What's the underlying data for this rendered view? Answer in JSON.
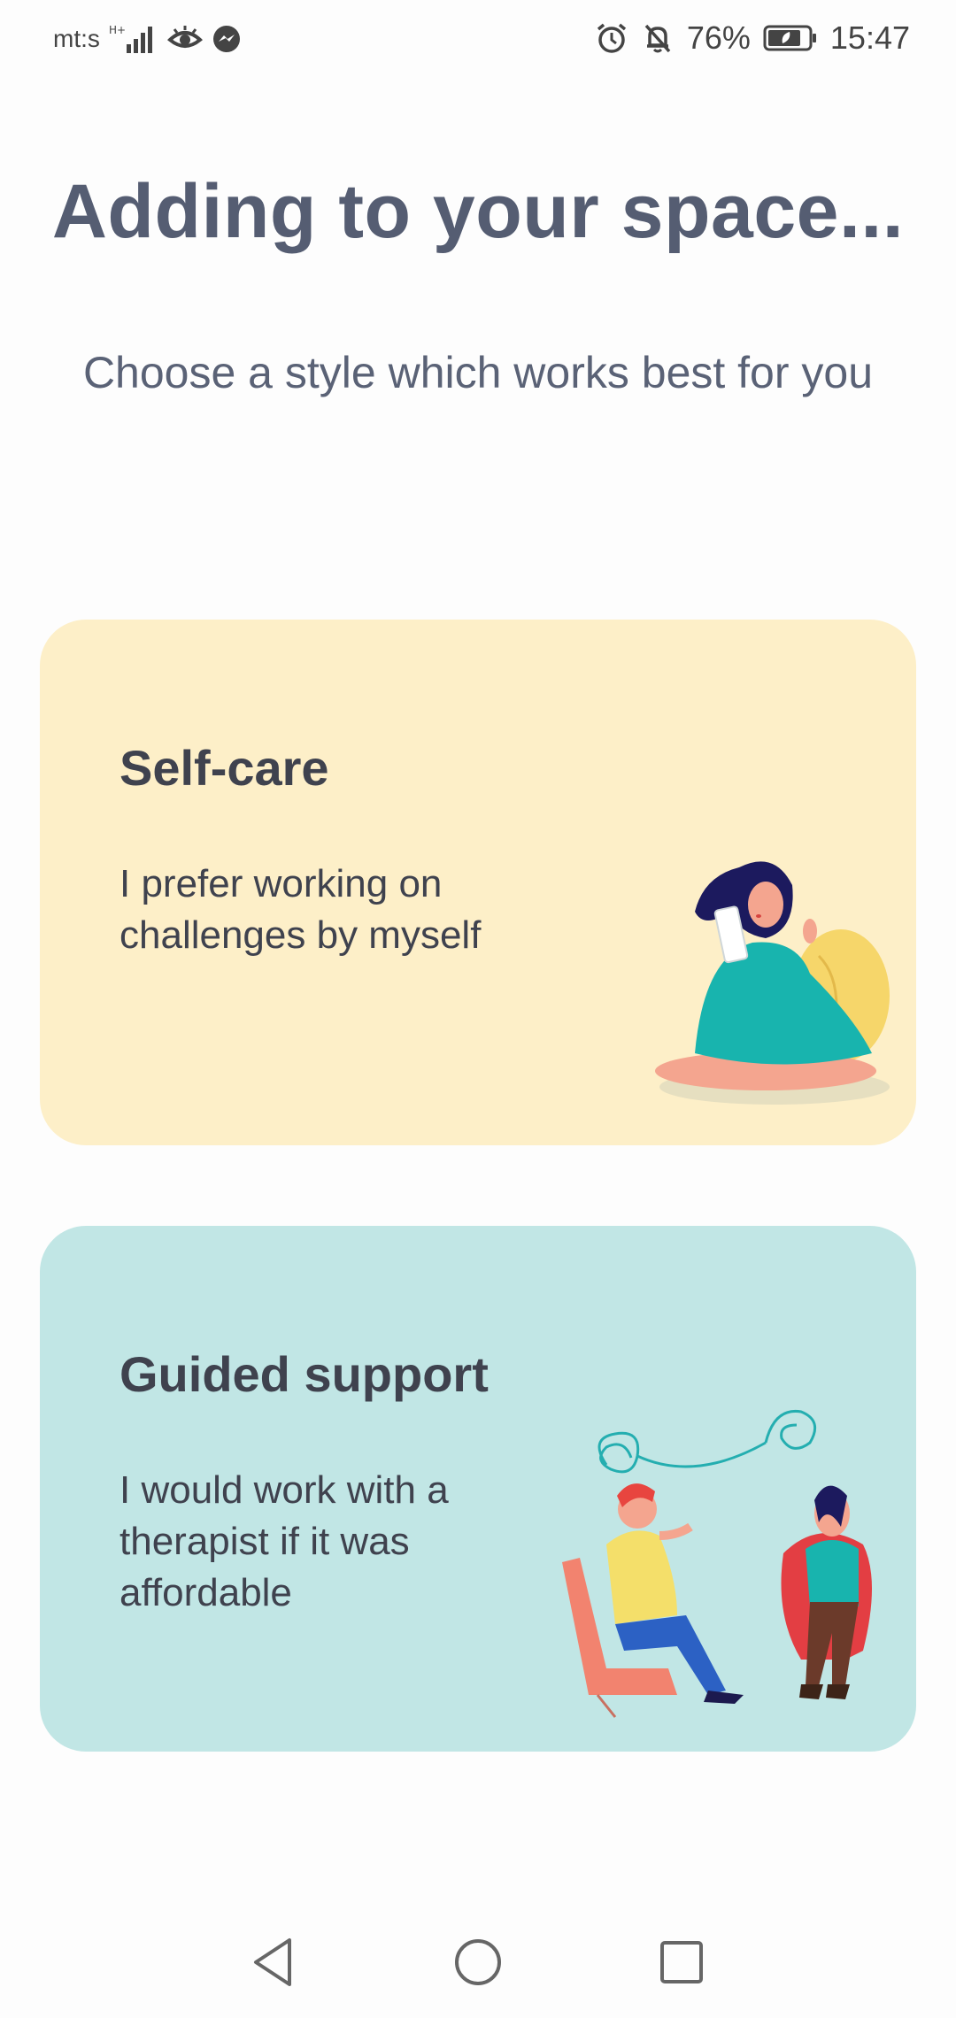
{
  "status_bar": {
    "carrier": "mt:s",
    "network_type": "H+",
    "battery_percent": "76%",
    "time": "15:47",
    "icons": [
      "signal-icon",
      "eye-icon",
      "messenger-icon",
      "alarm-icon",
      "bell-off-icon",
      "battery-icon"
    ]
  },
  "header": {
    "title": "Adding to your space...",
    "subtitle": "Choose a style which works best for you"
  },
  "cards": [
    {
      "title": "Self-care",
      "description": "I prefer working on challenges by myself",
      "background": "#fdefc8"
    },
    {
      "title": "Guided support",
      "description": "I would work with a therapist if it was affordable",
      "background": "#c1e6e5"
    }
  ],
  "nav_bar": {
    "icons": [
      "back-icon",
      "home-icon",
      "recents-icon"
    ]
  },
  "colors": {
    "title": "#555d72",
    "text": "#3f424e",
    "teal": "#1fb3b0",
    "yellow_card": "#fdefc8",
    "teal_card": "#c1e6e5"
  }
}
